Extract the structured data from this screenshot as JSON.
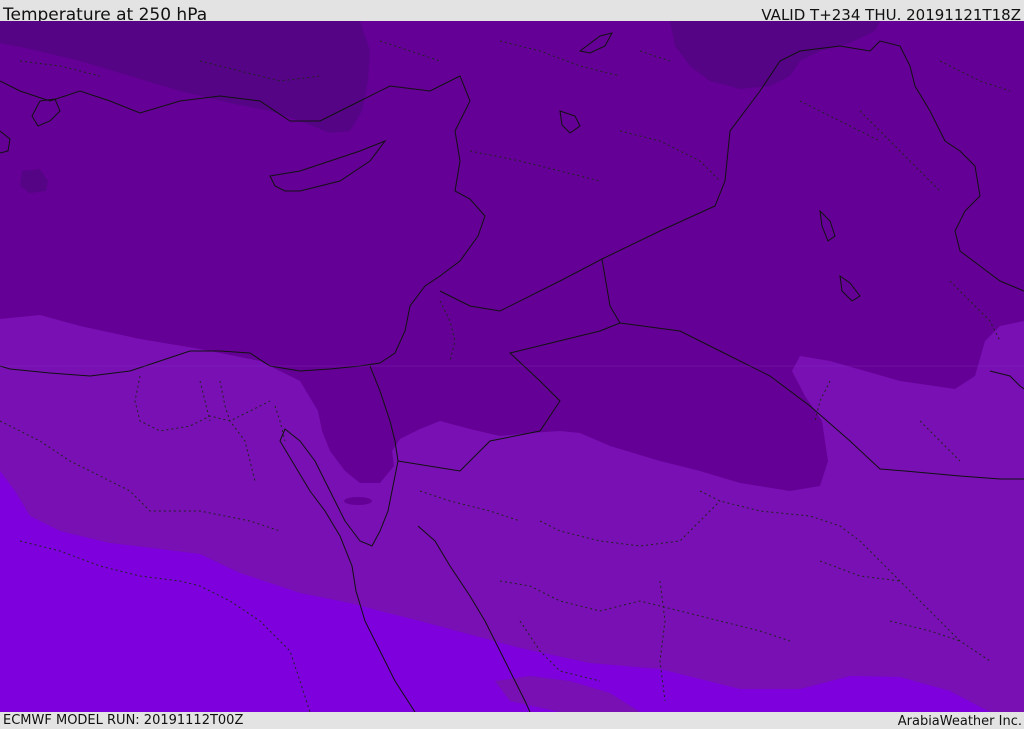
{
  "header": {
    "title": "Temperature at 250 hPa",
    "valid_time": "VALID T+234 THU. 20191121T18Z"
  },
  "footer": {
    "model_run": "ECMWF MODEL RUN: 20191112T00Z",
    "credit": "ArabiaWeather Inc."
  },
  "map": {
    "colors": {
      "band_coldest": "#550486",
      "band_cold": "#650096",
      "band_mid": "#7810b3",
      "band_warm": "#7d00dd",
      "border_line": "#111111"
    }
  }
}
